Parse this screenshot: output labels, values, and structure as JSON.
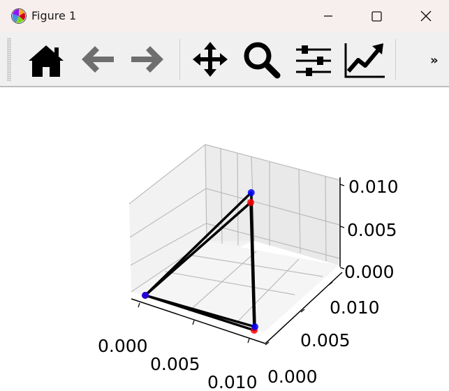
{
  "window": {
    "title": "Figure 1",
    "icon": "matplotlib-icon",
    "controls": [
      "minimize-icon",
      "maximize-icon",
      "close-icon"
    ]
  },
  "toolbar": {
    "tools": [
      {
        "name": "home",
        "icon": "home-icon"
      },
      {
        "name": "back",
        "icon": "arrow-left-icon"
      },
      {
        "name": "forward",
        "icon": "arrow-right-icon"
      },
      {
        "name": "pan",
        "icon": "move-icon"
      },
      {
        "name": "zoom",
        "icon": "magnifier-icon"
      },
      {
        "name": "subplots",
        "icon": "sliders-icon"
      },
      {
        "name": "customize",
        "icon": "line-chart-icon"
      }
    ],
    "overflow": "»"
  },
  "colors": {
    "titlebar_bg": "#f7eeee",
    "toolbar_bg": "#f0f0f0",
    "disabled_icon": "#6e6e6e",
    "series_red": "#ff0000",
    "series_blue": "#0000ff",
    "edges": "#000000"
  },
  "chart_data": {
    "type": "scatter3d",
    "axes": {
      "x": {
        "ticks": [
          "0.000",
          "0.005",
          "0.010"
        ],
        "range": [
          0,
          0.01
        ]
      },
      "y": {
        "ticks": [
          "0.000",
          "0.005",
          "0.010"
        ],
        "range": [
          0,
          0.01
        ]
      },
      "z": {
        "ticks": [
          "0.000",
          "0.005",
          "0.010"
        ],
        "range": [
          0,
          0.01
        ]
      }
    },
    "grid": true,
    "series": [
      {
        "color": "red",
        "points": [
          [
            0,
            0,
            0
          ],
          [
            0.01,
            0,
            0
          ],
          [
            0.01,
            0,
            0.01
          ]
        ]
      },
      {
        "color": "blue",
        "points": [
          [
            0,
            0,
            0
          ],
          [
            0.01,
            0.001,
            0
          ],
          [
            0.01,
            0.001,
            0.0105
          ]
        ]
      }
    ],
    "edges": "black triangles connecting each series' points"
  }
}
